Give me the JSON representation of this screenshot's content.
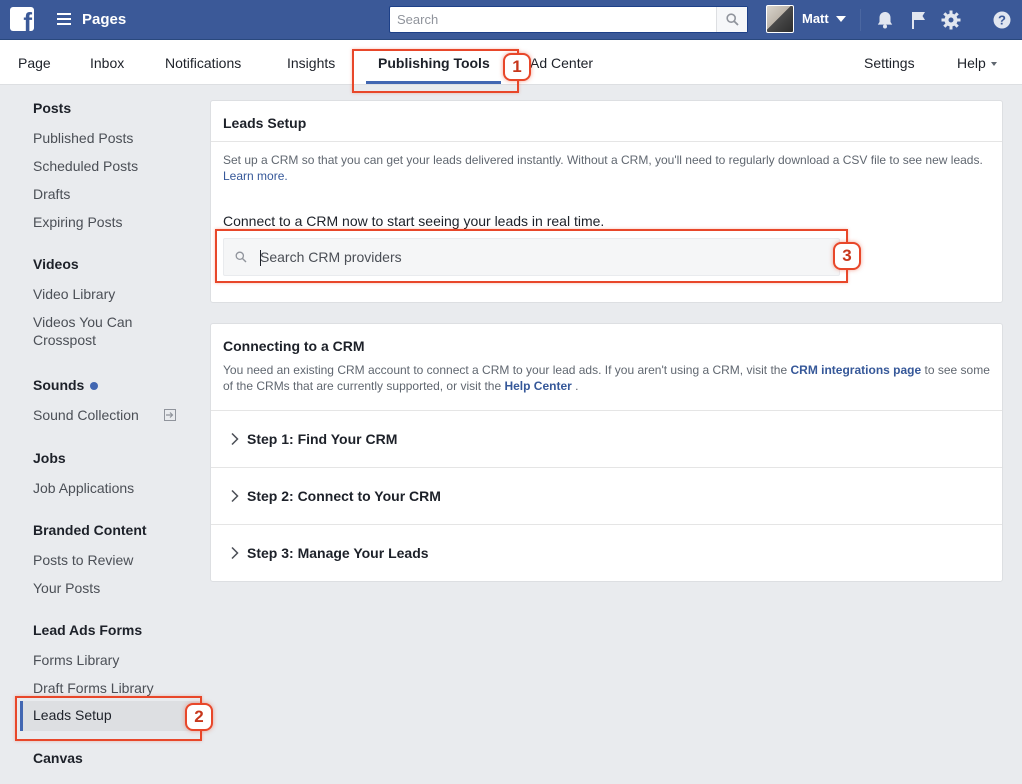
{
  "topbar": {
    "logo_letter": "f",
    "app_title": "Pages",
    "search_placeholder": "Search",
    "user_name": "Matt",
    "icons": [
      "facebook-logo-icon",
      "menu-icon",
      "search-icon",
      "caret-down-icon",
      "bell-icon",
      "flag-icon",
      "gear-icon",
      "help-icon"
    ]
  },
  "tabs": {
    "page": "Page",
    "inbox": "Inbox",
    "notifications": "Notifications",
    "insights": "Insights",
    "publishing_tools": "Publishing Tools",
    "ad_center": "Ad Center",
    "settings": "Settings",
    "help": "Help"
  },
  "sidebar": {
    "posts": {
      "heading": "Posts",
      "items": [
        "Published Posts",
        "Scheduled Posts",
        "Drafts",
        "Expiring Posts"
      ]
    },
    "videos": {
      "heading": "Videos",
      "items": [
        "Video Library",
        "Videos You Can Crosspost"
      ]
    },
    "sounds": {
      "heading": "Sounds",
      "items": [
        "Sound Collection"
      ]
    },
    "jobs": {
      "heading": "Jobs",
      "items": [
        "Job Applications"
      ]
    },
    "branded": {
      "heading": "Branded Content",
      "items": [
        "Posts to Review",
        "Your Posts"
      ]
    },
    "leads": {
      "heading": "Lead Ads Forms",
      "items": [
        "Forms Library",
        "Draft Forms Library",
        "Leads Setup"
      ]
    },
    "canvas": {
      "heading": "Canvas"
    }
  },
  "leads_setup": {
    "title": "Leads Setup",
    "description": "Set up a CRM so that you can get your leads delivered instantly. Without a CRM, you'll need to regularly download a CSV file to see new leads.",
    "learn_more": "Learn more.",
    "connect_text": "Connect to a CRM now to start seeing your leads in real time.",
    "search_placeholder": "Search CRM providers"
  },
  "connecting": {
    "title": "Connecting to a CRM",
    "desc_part1": "You need an existing CRM account to connect a CRM to your lead ads. If you aren't using a CRM, visit the",
    "crm_link": "CRM integrations page",
    "desc_part2": "to see some of the CRMs that are currently supported, or visit the",
    "help_link": "Help Center",
    "desc_end": ".",
    "steps": [
      "Step 1: Find Your CRM",
      "Step 2: Connect to Your CRM",
      "Step 3: Manage Your Leads"
    ]
  },
  "annotations": [
    "1",
    "2",
    "3"
  ],
  "colors": {
    "facebook_blue": "#3b5998",
    "accent": "#4267b2",
    "annotation_red": "#e8472a"
  }
}
